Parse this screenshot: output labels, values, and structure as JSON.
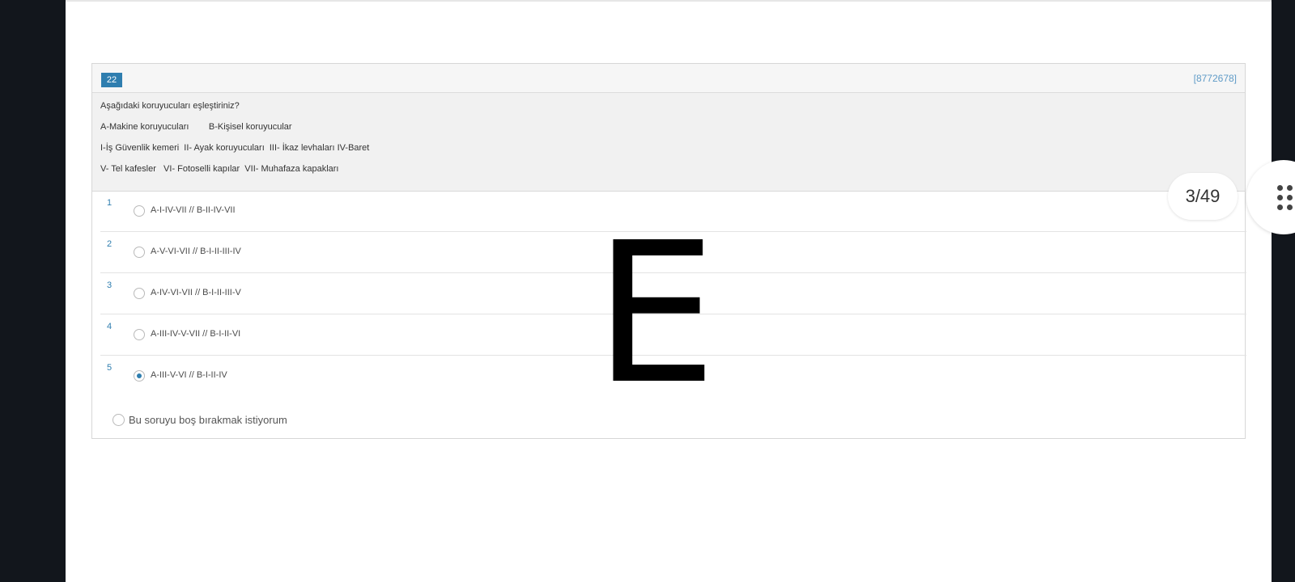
{
  "question": {
    "number": "22",
    "code": "[8772678]",
    "lines": [
      "Aşağıdaki koruyucuları eşleştiriniz?",
      "A-Makine koruyucuları        B-Kişisel koruyucular",
      "I-İş Güvenlik kemeri  II- Ayak koruyucuları  III- İkaz levhaları IV-Baret",
      "V- Tel kafesler   VI- Fotoselli kapılar  VII- Muhafaza kapakları"
    ],
    "options": [
      {
        "num": "1",
        "label": "A-I-IV-VII // B-II-IV-VII",
        "selected": false
      },
      {
        "num": "2",
        "label": "A-V-VI-VII // B-I-II-III-IV",
        "selected": false
      },
      {
        "num": "3",
        "label": "A-IV-VI-VII // B-I-II-III-V",
        "selected": false
      },
      {
        "num": "4",
        "label": "A-III-IV-V-VII // B-I-II-VI",
        "selected": false
      },
      {
        "num": "5",
        "label": "A-III-V-VI // B-I-II-IV",
        "selected": true
      }
    ],
    "skip_label": "Bu soruyu boş bırakmak istiyorum"
  },
  "overlay_letter": "E",
  "page_counter": "3/49",
  "icons": {
    "menu": "grid-dots-icon"
  }
}
